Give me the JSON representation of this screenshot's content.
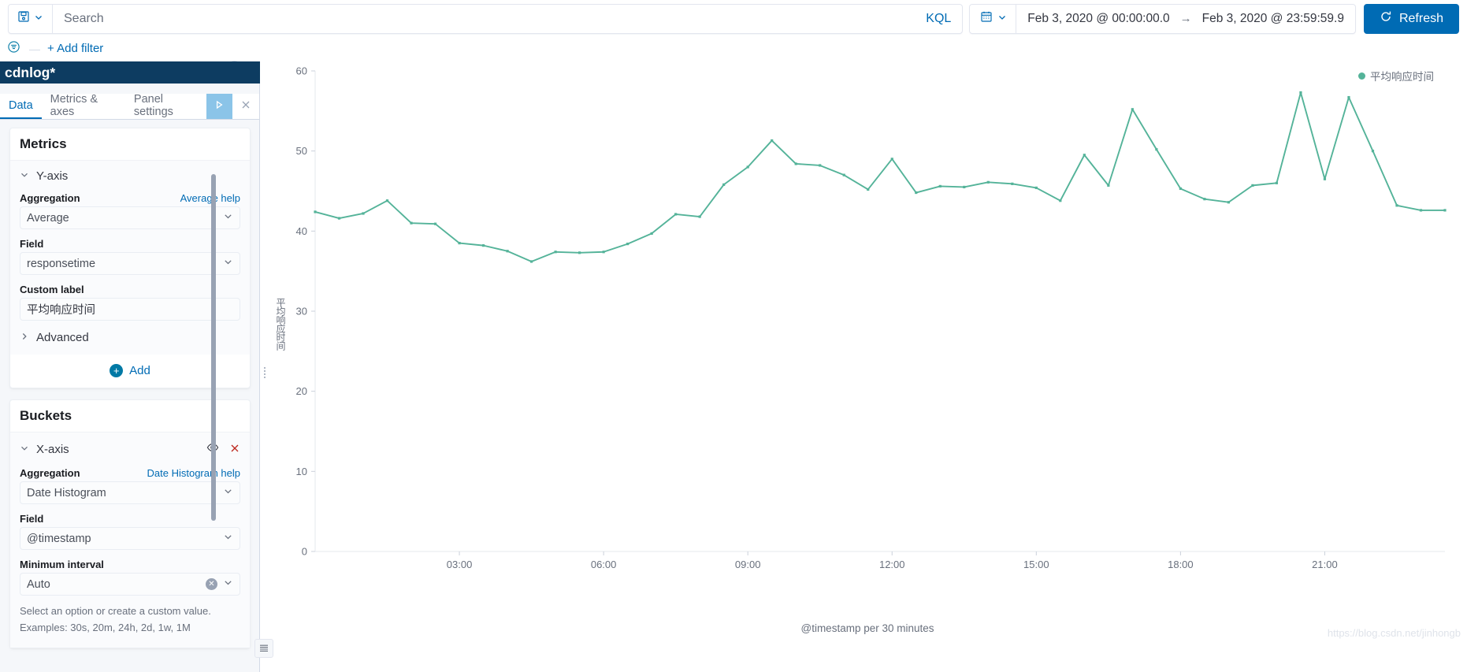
{
  "topbar": {
    "saved_query_icon": "save-icon",
    "saved_query_chevron": "chevron-down-icon",
    "search_placeholder": "Search",
    "search_value": "",
    "kql_label": "KQL",
    "calendar_icon": "calendar-icon",
    "date_start": "Feb 3, 2020 @ 00:00:00.0",
    "date_arrow": "→",
    "date_end": "Feb 3, 2020 @ 23:59:59.9",
    "refresh_label": "Refresh",
    "refresh_icon": "refresh-icon",
    "refresh_color": "#006bb4"
  },
  "filterbar": {
    "filter_icon": "filter-icon",
    "dash": "—",
    "add_filter_label": "+ Add filter"
  },
  "editor": {
    "index_title": "cdnlog*",
    "tabs": [
      {
        "label": "Data",
        "active": true
      },
      {
        "label": "Metrics & axes",
        "active": false
      },
      {
        "label": "Panel settings",
        "active": false
      }
    ],
    "apply_icon": "play-icon",
    "close_icon": "close-icon",
    "metrics": {
      "heading": "Metrics",
      "yaxis": {
        "chevron": "chevron-down-icon",
        "title": "Y-axis",
        "aggregation_label": "Aggregation",
        "aggregation_help": "Average help",
        "aggregation_value": "Average",
        "field_label": "Field",
        "field_value": "responsetime",
        "custom_label_label": "Custom label",
        "custom_label_value": "平均响应时间",
        "advanced_label": "Advanced",
        "advanced_chevron": "chevron-right-icon"
      },
      "add_label": "Add",
      "add_icon": "plus-circle-icon"
    },
    "buckets": {
      "heading": "Buckets",
      "xaxis": {
        "chevron": "chevron-down-icon",
        "title": "X-axis",
        "eye_icon": "eye-icon",
        "remove_icon": "close-x-icon",
        "aggregation_label": "Aggregation",
        "aggregation_help": "Date Histogram help",
        "aggregation_value": "Date Histogram",
        "field_label": "Field",
        "field_value": "@timestamp",
        "min_interval_label": "Minimum interval",
        "min_interval_value": "Auto",
        "min_interval_clear_icon": "clear-x-icon",
        "hint_line1": "Select an option or create a custom value.",
        "hint_line2": "Examples: 30s, 20m, 24h, 2d, 1w, 1M"
      }
    }
  },
  "chart": {
    "collapse_icon": "collapse-left-icon",
    "drag_handle_icon": "drag-handle-icon",
    "grid_button_icon": "legend-list-icon",
    "legend_label": "平均响应时间",
    "legend_color": "#54b399",
    "y_axis_title": "平均响应时间",
    "watermark": "https://blog.csdn.net/jinhongb"
  },
  "chart_data": {
    "type": "line",
    "title": "",
    "xlabel": "@timestamp per 30 minutes",
    "ylabel": "平均响应时间",
    "series_name": "平均响应时间",
    "color": "#54b399",
    "ylim": [
      0,
      60
    ],
    "yticks": [
      0,
      10,
      20,
      30,
      40,
      50,
      60
    ],
    "xticks": [
      "03:00",
      "06:00",
      "09:00",
      "12:00",
      "15:00",
      "18:00",
      "21:00"
    ],
    "grid": false,
    "legend_position": "top-right",
    "x": [
      "00:00",
      "00:30",
      "01:00",
      "01:30",
      "02:00",
      "02:30",
      "03:00",
      "03:30",
      "04:00",
      "04:30",
      "05:00",
      "05:30",
      "06:00",
      "06:30",
      "07:00",
      "07:30",
      "08:00",
      "08:30",
      "09:00",
      "09:30",
      "10:00",
      "10:30",
      "11:00",
      "11:30",
      "12:00",
      "12:30",
      "13:00",
      "13:30",
      "14:00",
      "14:30",
      "15:00",
      "15:30",
      "16:00",
      "16:30",
      "17:00",
      "17:30",
      "18:00",
      "18:30",
      "19:00",
      "19:30",
      "20:00",
      "20:30",
      "21:00",
      "21:30",
      "22:00",
      "22:30",
      "23:00",
      "23:30"
    ],
    "values": [
      42.4,
      41.6,
      42.2,
      43.8,
      41.0,
      40.9,
      38.5,
      38.2,
      37.5,
      36.2,
      37.4,
      37.3,
      37.4,
      38.4,
      39.7,
      42.1,
      41.8,
      45.8,
      48.0,
      51.3,
      48.4,
      48.2,
      47.0,
      45.2,
      49.0,
      44.8,
      45.6,
      45.5,
      46.1,
      45.9,
      45.4,
      43.8,
      49.5,
      45.7,
      55.2,
      50.2,
      45.3,
      44.0,
      43.6,
      45.7,
      46.0,
      57.3,
      46.5,
      56.7,
      50.0,
      43.2,
      42.6,
      42.6
    ]
  }
}
